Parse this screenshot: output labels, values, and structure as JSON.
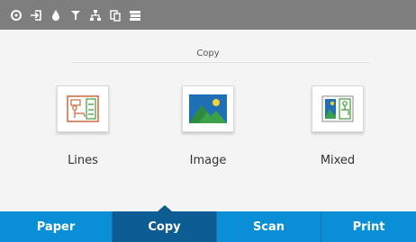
{
  "status_bar": {
    "icons": [
      "gear-icon",
      "sign-in-icon",
      "ink-drop-icon",
      "print-head-icon",
      "network-icon",
      "file-transfer-icon",
      "paper-stack-icon"
    ]
  },
  "copy_section": {
    "title": "Copy",
    "options": [
      {
        "label": "Lines",
        "icon": "lines-icon"
      },
      {
        "label": "Image",
        "icon": "image-icon"
      },
      {
        "label": "Mixed",
        "icon": "mixed-icon"
      }
    ]
  },
  "nav": {
    "tabs": [
      {
        "label": "Paper"
      },
      {
        "label": "Copy"
      },
      {
        "label": "Scan"
      },
      {
        "label": "Print"
      }
    ],
    "active": "Copy"
  },
  "colors": {
    "status_bar": "#7e7e7e",
    "nav_background": "#0a8fd6",
    "nav_active": "#0d5c94",
    "background": "#f4f4f4"
  }
}
